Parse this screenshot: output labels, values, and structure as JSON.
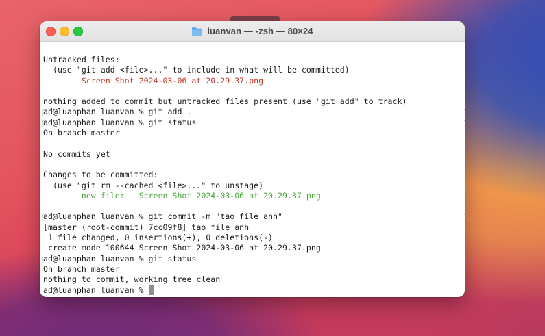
{
  "window": {
    "title": "luanvan — -zsh — 80×24"
  },
  "terminal": {
    "lines": [
      {
        "text": "Untracked files:"
      },
      {
        "text": "  (use \"git add <file>...\" to include in what will be committed)"
      },
      {
        "text": "        Screen Shot 2024-03-06 at 20.29.37.png",
        "color": "red"
      },
      {
        "text": ""
      },
      {
        "text": "nothing added to commit but untracked files present (use \"git add\" to track)"
      },
      {
        "text": "ad@luanphan luanvan % git add .",
        "marked": true
      },
      {
        "text": "ad@luanphan luanvan % git status",
        "marked": true
      },
      {
        "text": "On branch master"
      },
      {
        "text": ""
      },
      {
        "text": "No commits yet"
      },
      {
        "text": ""
      },
      {
        "text": "Changes to be committed:"
      },
      {
        "text": "  (use \"git rm --cached <file>...\" to unstage)"
      },
      {
        "text": "        new file:   Screen Shot 2024-03-06 at 20.29.37.png",
        "color": "green"
      },
      {
        "text": ""
      },
      {
        "text": "ad@luanphan luanvan % git commit -m \"tao file anh\"",
        "marked": true
      },
      {
        "text": "[master (root-commit) 7cc09f8] tao file anh"
      },
      {
        "text": " 1 file changed, 0 insertions(+), 0 deletions(-)"
      },
      {
        "text": " create mode 100644 Screen Shot 2024-03-06 at 20.29.37.png"
      },
      {
        "text": "ad@luanphan luanvan % git status",
        "marked": true
      },
      {
        "text": "On branch master"
      },
      {
        "text": "nothing to commit, working tree clean"
      }
    ],
    "prompt": "ad@luanphan luanvan % "
  },
  "colors": {
    "red_text": "#c0392b",
    "green_text": "#48a83a",
    "folder_icon": "#5fa8e6"
  }
}
